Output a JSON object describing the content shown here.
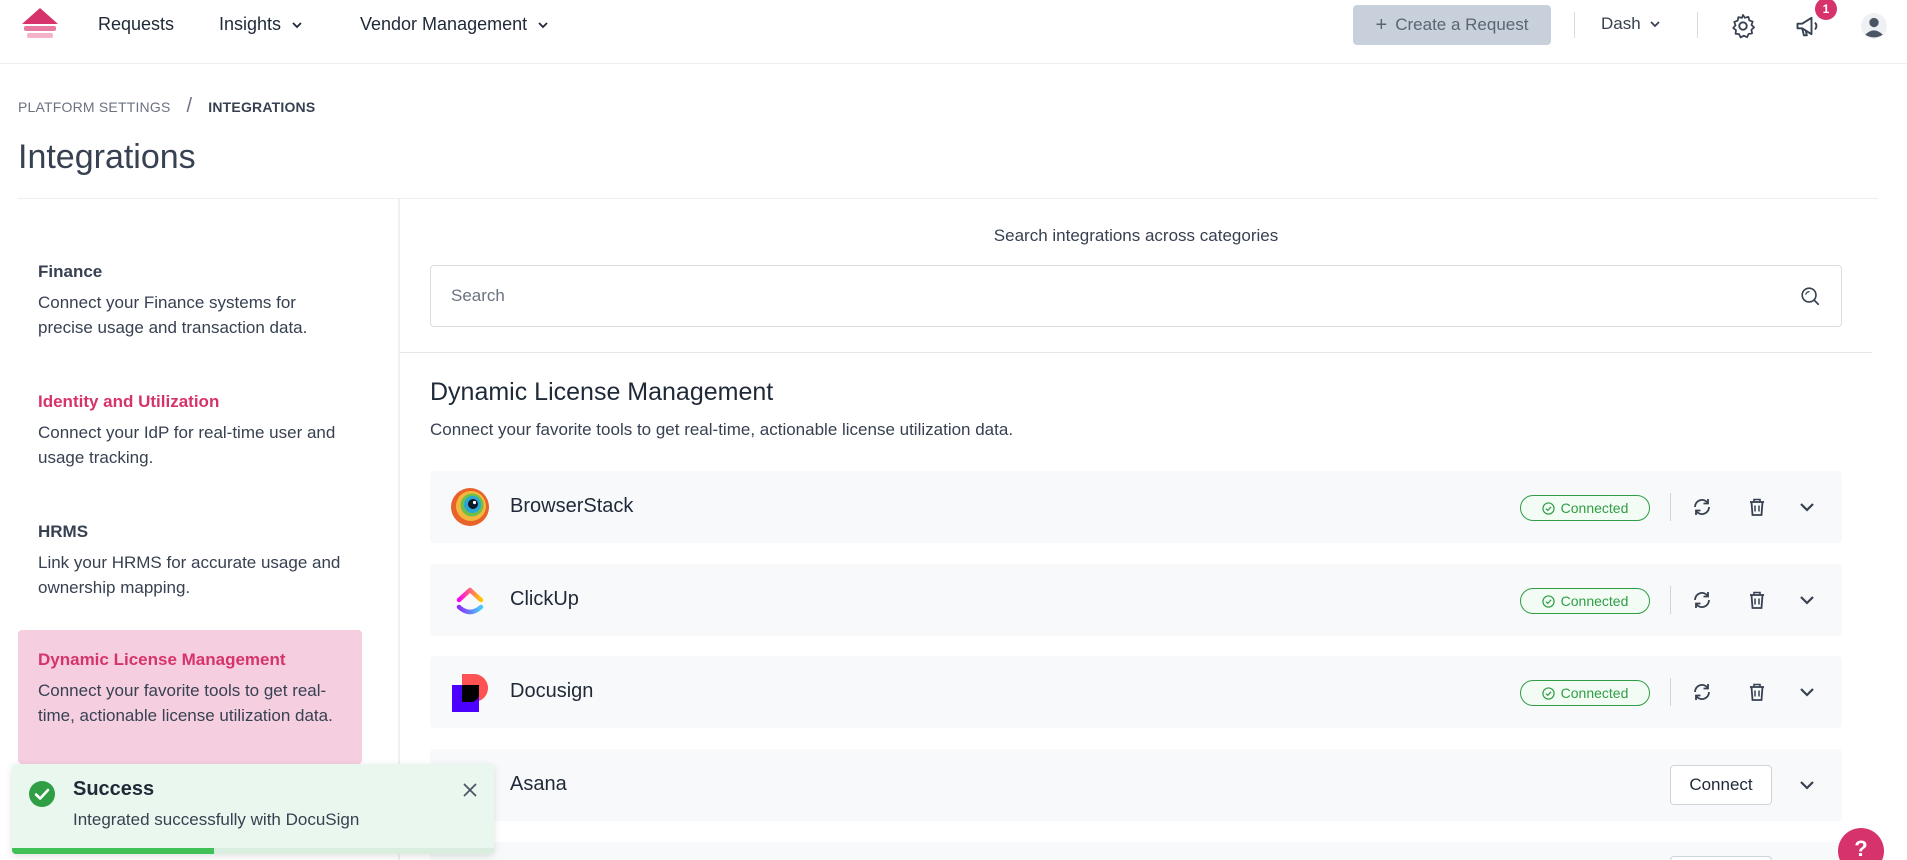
{
  "nav": {
    "items": [
      {
        "label": "Requests"
      },
      {
        "label": "Insights"
      },
      {
        "label": "Vendor Management"
      }
    ],
    "create_label": "Create a Request",
    "workspace_label": "Dash",
    "notification_count": "1"
  },
  "breadcrumb": {
    "parent": "PLATFORM SETTINGS",
    "separator": "/",
    "current": "INTEGRATIONS"
  },
  "page_title": "Integrations",
  "categories": [
    {
      "title": "Finance",
      "desc": "Connect your Finance systems for precise usage and transaction data."
    },
    {
      "title": "Identity and Utilization",
      "desc": "Connect your IdP for real-time user and usage tracking."
    },
    {
      "title": "HRMS",
      "desc": "Link your HRMS for accurate usage and ownership mapping."
    },
    {
      "title": "Dynamic License Management",
      "desc": "Connect your favorite tools to get real-time, actionable license utilization data."
    }
  ],
  "search": {
    "label": "Search integrations across categories",
    "placeholder": "Search"
  },
  "section": {
    "title": "Dynamic License Management",
    "desc": "Connect your favorite tools to get real-time, actionable license utilization data."
  },
  "integrations": [
    {
      "name": "BrowserStack",
      "status": "Connected"
    },
    {
      "name": "ClickUp",
      "status": "Connected"
    },
    {
      "name": "Docusign",
      "status": "Connected"
    },
    {
      "name": "Asana",
      "action": "Connect"
    }
  ],
  "toast": {
    "title": "Success",
    "message": "Integrated successfully with DocuSign",
    "progress": 0.42
  },
  "help_label": "?",
  "colors": {
    "brand": "#d6336c",
    "success": "#2f9e44",
    "active_bg": "#f5cfe0"
  }
}
